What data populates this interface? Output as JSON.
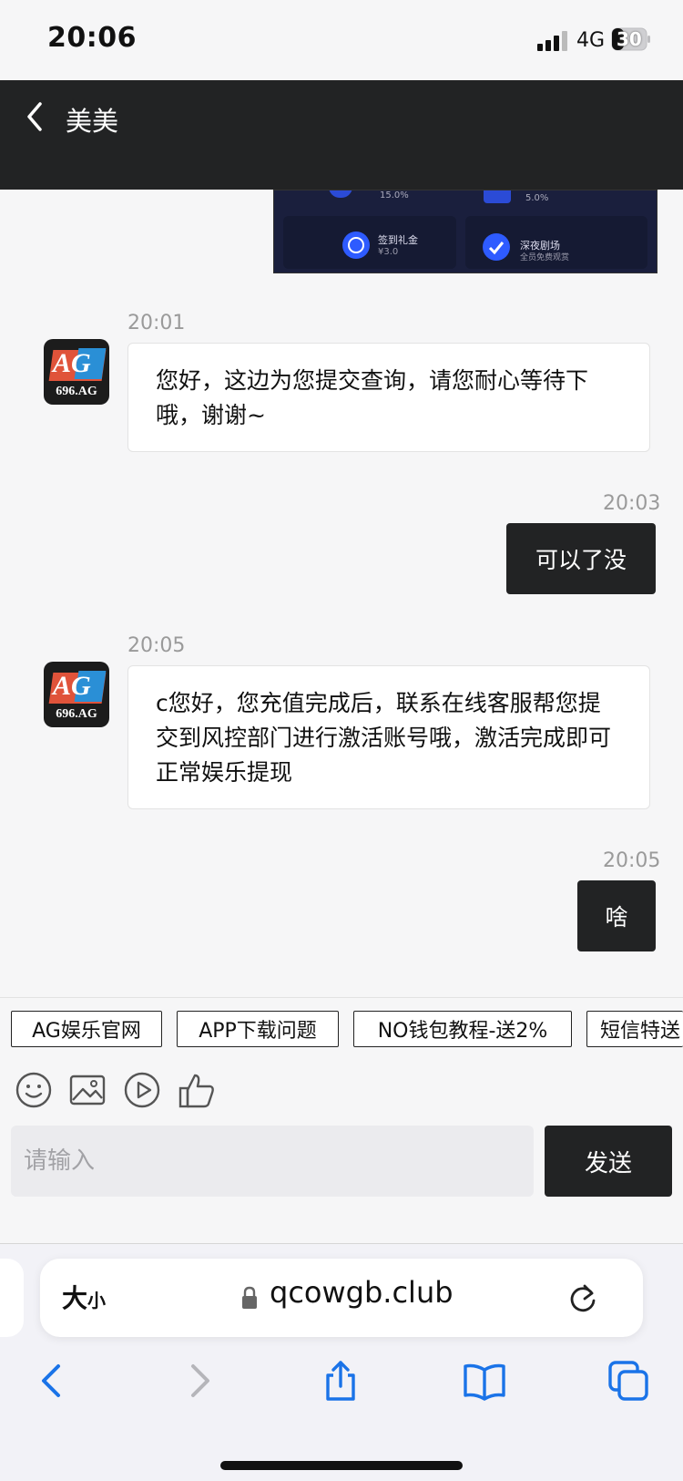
{
  "status_bar": {
    "time": "20:06",
    "network": "4G",
    "battery": "30"
  },
  "header": {
    "title": "美美"
  },
  "chat": {
    "image_message": {
      "label_1": "签到礼金",
      "value_1": "¥3.0",
      "label_2": "深夜剧场",
      "value_2": "全员免费观赏",
      "pct_1": "15.0%",
      "pct_2": "5.0%"
    },
    "messages": [
      {
        "time": "20:01",
        "from": "agent",
        "text": "您好，这边为您提交查询，请您耐心等待下哦，谢谢~"
      },
      {
        "time": "20:03",
        "from": "user",
        "text": "可以了没"
      },
      {
        "time": "20:05",
        "from": "agent",
        "text": "c您好，您充值完成后，联系在线客服帮您提交到风控部门进行激活账号哦，激活完成即可正常娱乐提现"
      },
      {
        "time": "20:05",
        "from": "user",
        "text": "啥"
      }
    ],
    "avatar": {
      "top_text": "AG",
      "bottom_text": "696.AG"
    }
  },
  "quick_replies": [
    "AG娱乐官网",
    "APP下载问题",
    "NO钱包教程-送2%",
    "短信特送"
  ],
  "toolbar_icons": [
    "emoji-icon",
    "image-icon",
    "video-icon",
    "thumbs-up-icon"
  ],
  "composer": {
    "placeholder": "请输入",
    "send_label": "发送"
  },
  "browser": {
    "text_size_big": "大",
    "text_size_small": "小",
    "url": "qcowgb.club"
  },
  "colors": {
    "dark": "#222324",
    "background": "#f6f6f7",
    "accent": "#1a73e8"
  }
}
